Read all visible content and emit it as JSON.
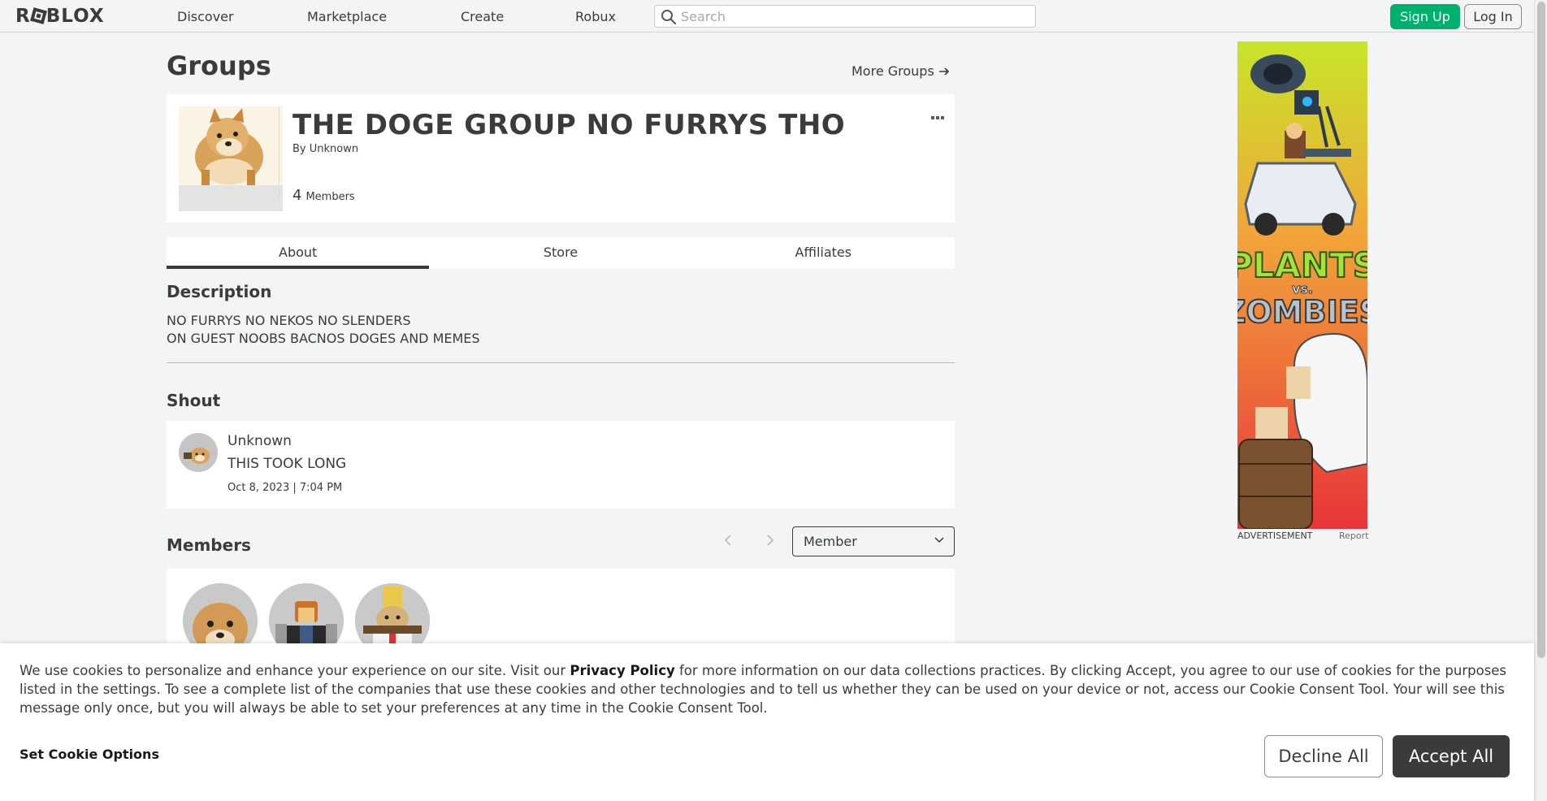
{
  "header": {
    "logo": "ROBLOX",
    "nav": [
      "Discover",
      "Marketplace",
      "Create",
      "Robux"
    ],
    "search_placeholder": "Search",
    "signup_label": "Sign Up",
    "login_label": "Log In"
  },
  "page": {
    "title": "Groups",
    "more_groups": "More Groups"
  },
  "group": {
    "name": "THE DOGE GROUP NO FURRYS THO",
    "by_prefix": "By",
    "owner": "Unknown",
    "member_count": "4",
    "members_label": "Members"
  },
  "tabs": [
    "About",
    "Store",
    "Affiliates"
  ],
  "about": {
    "description_heading": "Description",
    "description_lines": [
      "NO FURRYS NO NEKOS NO SLENDERS",
      "ON GUEST NOOBS BACNOS DOGES AND MEMES"
    ],
    "shout_heading": "Shout",
    "shout": {
      "user": "Unknown",
      "text": "THIS TOOK LONG",
      "date": "Oct 8, 2023 | 7:04 PM"
    },
    "members_heading": "Members",
    "role_filter": "Member"
  },
  "ad": {
    "label": "ADVERTISEMENT",
    "report": "Report",
    "artwork_text_1": "PLANTS",
    "artwork_text_2": "vs.",
    "artwork_text_3": "ZOMBIES"
  },
  "cookie": {
    "text_before": "We use cookies to personalize and enhance your experience on our site. Visit our ",
    "privacy_link": "Privacy Policy",
    "text_after": " for more information on our data collections practices. By clicking Accept, you agree to our use of cookies for the purposes listed in the settings. To see a complete list of the companies that use these cookies and other technologies and to tell us whether they can be used on your device or not, access our Cookie Consent Tool. Your will see this message only once, but you will always be able to set your preferences at any time in the Cookie Consent Tool.",
    "set_options": "Set Cookie Options",
    "decline": "Decline All",
    "accept": "Accept All"
  },
  "colors": {
    "signup_green": "#00b06f",
    "text_dark": "#393b3d",
    "page_bg": "#f2f4f5"
  }
}
